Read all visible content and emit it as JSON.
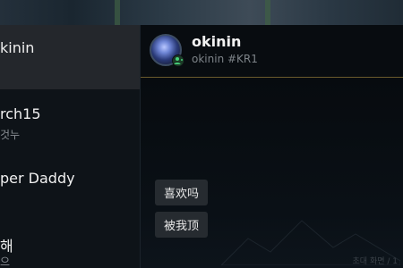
{
  "friends": [
    {
      "name": "kinin",
      "sub": ""
    },
    {
      "name": "rch15",
      "sub": "것누"
    },
    {
      "name": "per Daddy",
      "sub": ""
    },
    {
      "name": "해",
      "sub": "으"
    }
  ],
  "chat": {
    "name": "okinin",
    "tag": "okinin #KR1",
    "messages": [
      "喜欢吗",
      "被我顶"
    ],
    "footer": "초대 화면 / 1"
  },
  "colors": {
    "accent_line": "#6a5a2c",
    "bubble": "#262b30",
    "online_badge": "#1c3b27"
  },
  "icons": {
    "avatar": "profile-avatar",
    "badge": "friend-status-icon"
  }
}
